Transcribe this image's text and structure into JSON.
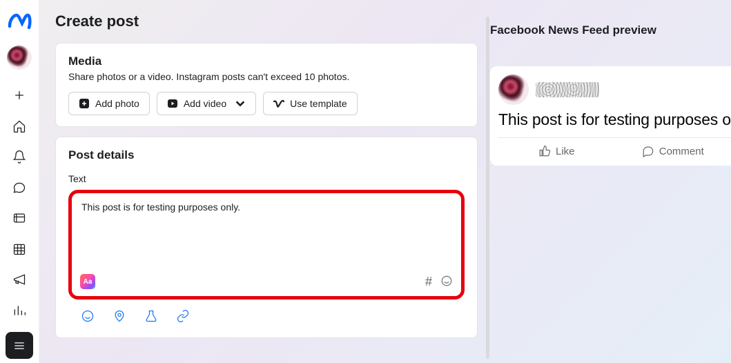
{
  "page": {
    "title": "Create post"
  },
  "media": {
    "title": "Media",
    "subtitle": "Share photos or a video. Instagram posts can't exceed 10 photos.",
    "buttons": {
      "add_photo": "Add photo",
      "add_video": "Add video",
      "use_template": "Use template"
    }
  },
  "post_details": {
    "title": "Post details",
    "text_label": "Text",
    "text_value": "This post is for testing purposes only.",
    "aa_badge": "Aa",
    "hashtag": "#"
  },
  "preview": {
    "title": "Facebook News Feed preview",
    "post_text": "This post is for testing purposes o",
    "like_label": "Like",
    "comment_label": "Comment"
  }
}
